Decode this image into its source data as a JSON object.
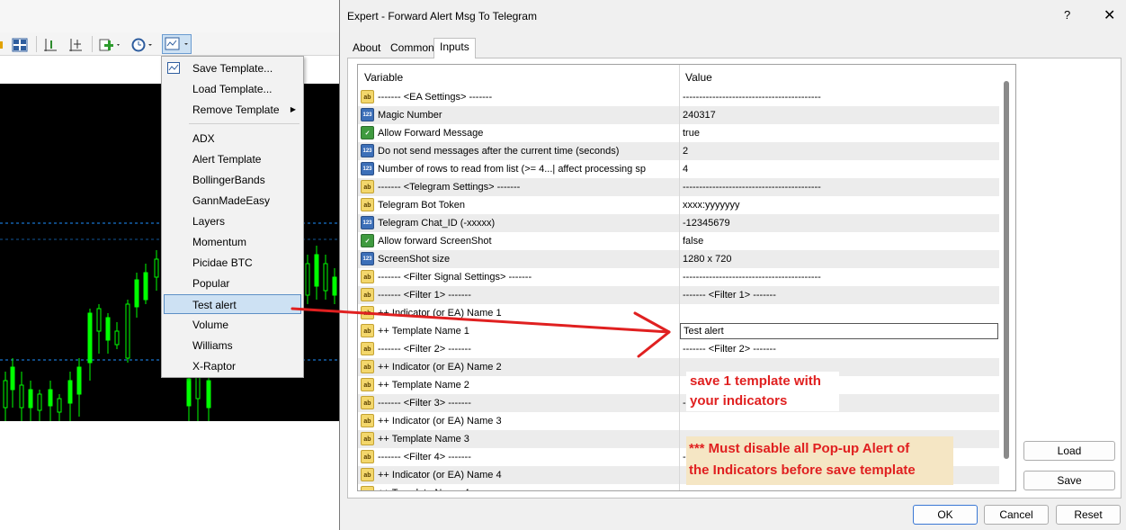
{
  "dialog": {
    "title": "Expert - Forward Alert Msg To Telegram",
    "help": "?",
    "close": "✕",
    "tabs": [
      {
        "label": "About"
      },
      {
        "label": "Common"
      },
      {
        "label": "Inputs",
        "active": true
      }
    ],
    "columns": {
      "variable": "Variable",
      "value": "Value"
    },
    "rows": [
      {
        "type": "ab",
        "variable": "------- <EA Settings> -------",
        "value": "------------------------------------------"
      },
      {
        "type": "123",
        "variable": "Magic Number",
        "value": "240317"
      },
      {
        "type": "bool",
        "variable": "Allow Forward Message",
        "value": "true"
      },
      {
        "type": "123",
        "variable": "Do not send messages after the current time (seconds)",
        "value": "2"
      },
      {
        "type": "123",
        "variable": "Number of rows to read from list (>= 4...| affect processing sp",
        "value": "4"
      },
      {
        "type": "ab",
        "variable": "------- <Telegram Settings> -------",
        "value": "------------------------------------------"
      },
      {
        "type": "ab",
        "variable": "Telegram Bot Token",
        "value": "xxxx:yyyyyyy"
      },
      {
        "type": "123",
        "variable": "Telegram Chat_ID (-xxxxx)",
        "value": "-12345679"
      },
      {
        "type": "bool",
        "variable": "Allow forward ScreenShot",
        "value": "false"
      },
      {
        "type": "123",
        "variable": "ScreenShot size",
        "value": "1280 x 720"
      },
      {
        "type": "ab",
        "variable": "------- <Filter Signal Settings> -------",
        "value": "------------------------------------------"
      },
      {
        "type": "ab",
        "variable": "------- <Filter 1> -------",
        "value": "------- <Filter 1> -------"
      },
      {
        "type": "ab",
        "variable": "++ Indicator (or EA) Name 1",
        "value": ""
      },
      {
        "type": "ab",
        "variable": "++ Template Name 1",
        "value": "Test alert",
        "editing": true
      },
      {
        "type": "ab",
        "variable": "------- <Filter 2> -------",
        "value": "------- <Filter 2> -------"
      },
      {
        "type": "ab",
        "variable": "++ Indicator (or EA) Name 2",
        "value": ""
      },
      {
        "type": "ab",
        "variable": "++ Template Name 2",
        "value": ""
      },
      {
        "type": "ab",
        "variable": "------- <Filter 3> -------",
        "value": "---"
      },
      {
        "type": "ab",
        "variable": "++ Indicator (or EA) Name 3",
        "value": ""
      },
      {
        "type": "ab",
        "variable": "++ Template Name 3",
        "value": ""
      },
      {
        "type": "ab",
        "variable": "------- <Filter 4> -------",
        "value": "---"
      },
      {
        "type": "ab",
        "variable": "++ Indicator (or EA) Name 4",
        "value": ""
      },
      {
        "type": "ab",
        "variable": "++ Template Name 4",
        "value": ""
      }
    ],
    "buttons": {
      "load": "Load",
      "save": "Save",
      "ok": "OK",
      "cancel": "Cancel",
      "reset": "Reset"
    }
  },
  "template_menu": {
    "items": [
      {
        "label": "Save Template...",
        "icon": "template-icon"
      },
      {
        "label": "Load Template..."
      },
      {
        "label": "Remove Template",
        "submenu": true
      },
      {
        "label": "ADX"
      },
      {
        "label": "Alert Template"
      },
      {
        "label": "BollingerBands"
      },
      {
        "label": "GannMadeEasy"
      },
      {
        "label": "Layers"
      },
      {
        "label": "Momentum"
      },
      {
        "label": "Picidae BTC"
      },
      {
        "label": "Popular"
      },
      {
        "label": "Test alert",
        "selected": true
      },
      {
        "label": "Volume"
      },
      {
        "label": "Williams"
      },
      {
        "label": "X-Raptor"
      }
    ]
  },
  "annotations": {
    "note1_line1": "save 1 template with",
    "note1_line2": "your indicators",
    "note2_line1": "*** Must disable all Pop-up Alert of",
    "note2_line2": "the Indicators before save template",
    "arrow_color": "#e02020"
  },
  "colors": {
    "chart_bg": "#000000",
    "candle": "#00ff00",
    "level_line": "#1e90ff"
  }
}
